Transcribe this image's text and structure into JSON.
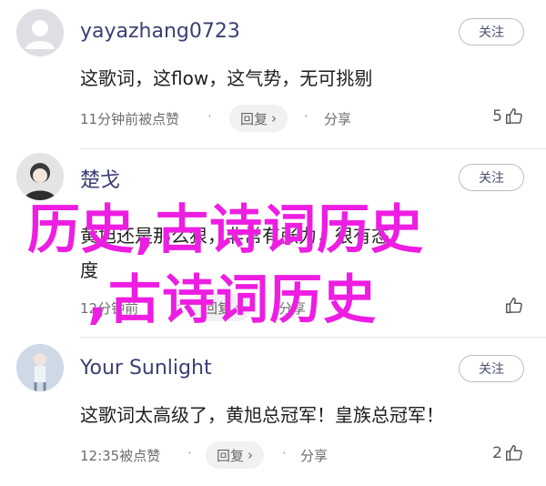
{
  "comments": [
    {
      "username": "yayazhang0723",
      "follow_label": "关注",
      "content_lines": [
        "这歌词，这flow，这气势，无可挑剔"
      ],
      "time": "11分钟前被点赞",
      "reply_label": "回复",
      "share_label": "分享",
      "likes": "5"
    },
    {
      "username": "楚戈",
      "follow_label": "关注",
      "content_lines": [
        "黄旭还是那么狠，非常有张力，很有态",
        "度"
      ],
      "time": "12分钟前",
      "reply_label": "回复",
      "share_label": "分享",
      "likes": ""
    },
    {
      "username": "Your Sunlight",
      "follow_label": "关注",
      "content_lines": [
        "这歌词太高级了，黄旭总冠军！皇族总冠军！"
      ],
      "time": "12:35被点赞",
      "reply_label": "回复",
      "share_label": "分享",
      "likes": "2"
    }
  ],
  "watermark": {
    "line1": "历史,古诗词历史",
    "line2": ",古诗词历史",
    "color": "#ee1de2"
  },
  "icons": {
    "avatar_default": "default-user-icon",
    "reply_arrow": "chevron-right-icon",
    "like": "thumbs-up-icon"
  }
}
